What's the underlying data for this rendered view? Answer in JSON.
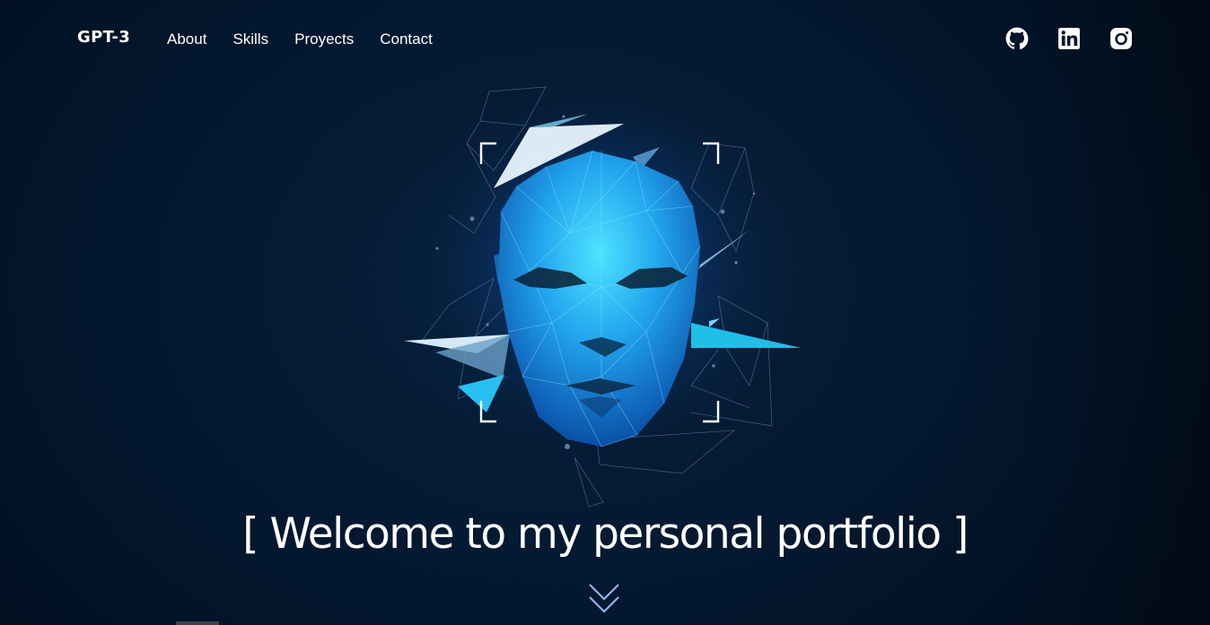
{
  "navbar": {
    "logo": "GPT-3",
    "links": [
      {
        "label": "About"
      },
      {
        "label": "Skills"
      },
      {
        "label": "Proyects"
      },
      {
        "label": "Contact"
      }
    ],
    "socials": [
      {
        "icon": "github-icon"
      },
      {
        "icon": "linkedin-icon"
      },
      {
        "icon": "instagram-icon"
      }
    ]
  },
  "hero": {
    "image_icon": "low-poly-face-illustration",
    "headline": "[ Welcome to my personal portfolio ]",
    "scroll_icon": "double-chevron-down-icon"
  },
  "colors": {
    "background": "#041226",
    "text": "#ffffff",
    "accent": "#29b6f6",
    "chevron": "#8fb4e8"
  }
}
